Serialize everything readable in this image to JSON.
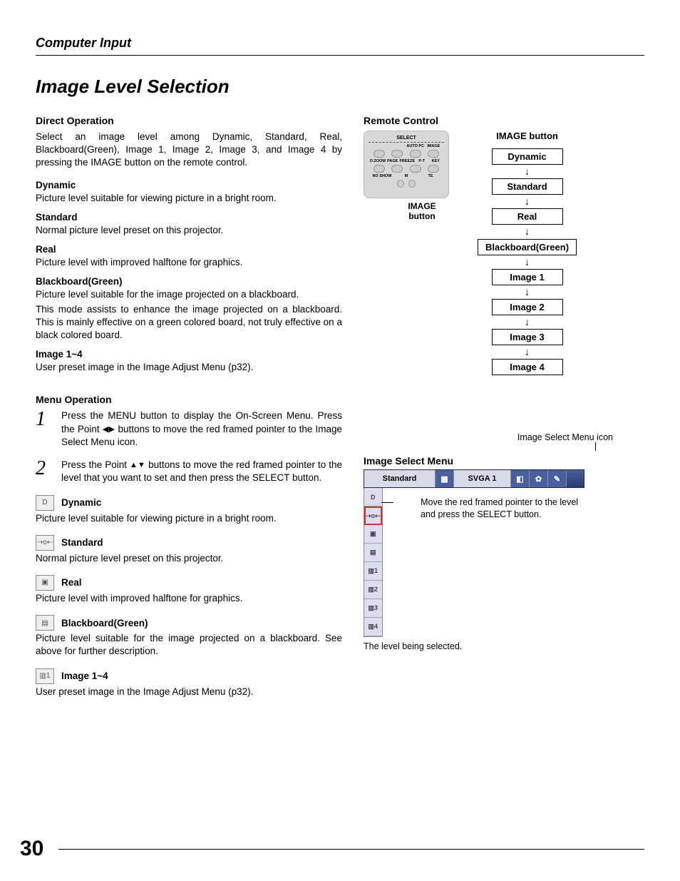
{
  "header": {
    "section": "Computer Input"
  },
  "title": "Image Level Selection",
  "direct": {
    "heading": "Direct Operation",
    "intro": "Select an image level among Dynamic, Standard, Real, Blackboard(Green), Image 1, Image 2, Image 3, and Image 4 by pressing the IMAGE button on the remote control.",
    "items": {
      "dynamic": {
        "name": "Dynamic",
        "desc": "Picture level suitable for viewing picture in a bright room."
      },
      "standard": {
        "name": "Standard",
        "desc": "Normal picture level preset on this projector."
      },
      "real": {
        "name": "Real",
        "desc": "Picture level with improved halftone for graphics."
      },
      "blackboard": {
        "name": "Blackboard(Green)",
        "desc": "Picture level suitable for the image projected on a blackboard.",
        "desc2": "This mode assists to enhance the image projected on a blackboard.  This is mainly effective on a green colored board, not truly effective on a black colored board."
      },
      "image14": {
        "name": "Image 1~4",
        "desc": "User preset image in the Image Adjust Menu (p32)."
      }
    }
  },
  "menu_op": {
    "heading": "Menu Operation",
    "step1_pre": "Press the MENU button to display the On-Screen Menu.  Press the Point ",
    "step1_post": " buttons to move the red framed pointer to the Image Select Menu icon.",
    "step2_pre": "Press the Point ",
    "step2_post": " buttons to move the red framed pointer to the level that you want to set and then press the SELECT button.",
    "icons": {
      "dynamic": {
        "name": "Dynamic",
        "desc": "Picture level suitable for viewing picture in a bright room."
      },
      "standard": {
        "name": "Standard",
        "desc": "Normal picture level preset on this projector."
      },
      "real": {
        "name": "Real",
        "desc": "Picture level with improved halftone for graphics."
      },
      "blackboard": {
        "name": "Blackboard(Green)",
        "desc": "Picture level suitable for the image projected on a blackboard.   See above for further description."
      },
      "image14": {
        "name": "Image 1~4",
        "desc": "User preset image in the Image Adjust Menu (p32)."
      }
    }
  },
  "remote": {
    "heading": "Remote Control",
    "select_label": "SELECT",
    "row_labels": [
      "D.ZOOM",
      "PAGE",
      "FREEZE",
      "P-T",
      "KEY"
    ],
    "row_labels2": [
      "NO SHOW",
      "M",
      "TE"
    ],
    "autopc": "AUTO PC",
    "image_btn": "IMAGE",
    "caption_line1": "IMAGE",
    "caption_line2": "button"
  },
  "flow": {
    "title": "IMAGE button",
    "items": [
      "Dynamic",
      "Standard",
      "Real",
      "Blackboard(Green)",
      "Image 1",
      "Image 2",
      "Image 3",
      "Image 4"
    ]
  },
  "select_menu": {
    "note": "Image Select Menu icon",
    "title": "Image Select Menu",
    "bar": {
      "name": "Standard",
      "mode": "SVGA 1"
    },
    "side_icons": [
      "D",
      "⇢o⇠",
      "▣",
      "▤",
      "▥1",
      "▥2",
      "▥3",
      "▥4"
    ],
    "hint": "Move the red framed pointer to the level and press the SELECT button.",
    "caption": "The level being selected."
  },
  "page_number": "30"
}
